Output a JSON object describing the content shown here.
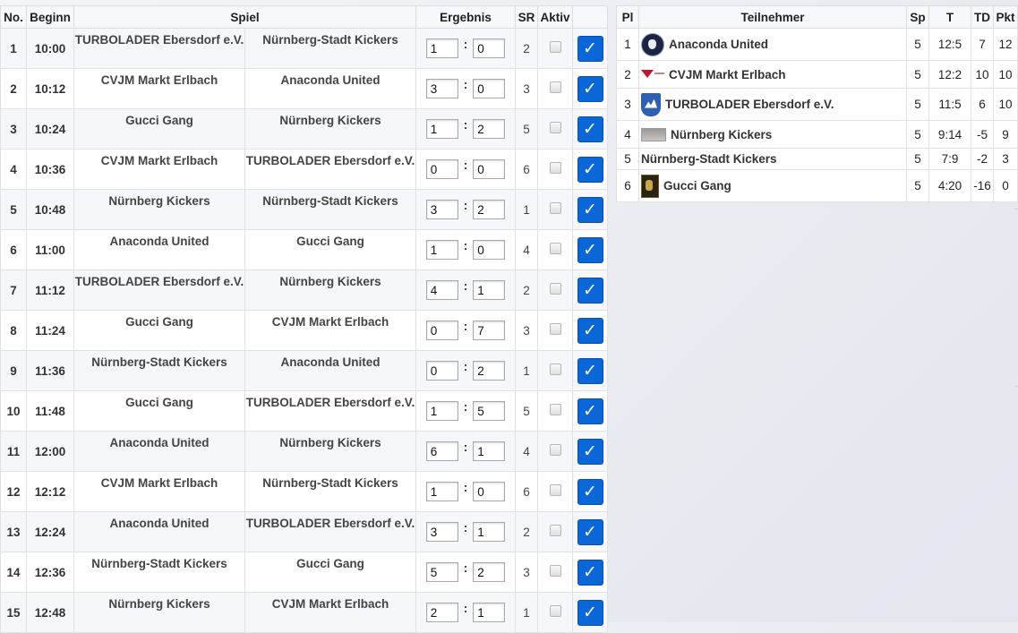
{
  "games": {
    "headers": {
      "no": "No.",
      "start": "Beginn",
      "game": "Spiel",
      "result": "Ergebnis",
      "sr": "SR",
      "active": "Aktiv"
    },
    "rows": [
      {
        "no": "1",
        "time": "10:00",
        "home": "TURBOLADER Ebersdorf e.V.",
        "away": "Nürnberg-Stadt Kickers",
        "score_home": "1",
        "score_away": "0",
        "sr": "2"
      },
      {
        "no": "2",
        "time": "10:12",
        "home": "CVJM Markt Erlbach",
        "away": "Anaconda United",
        "score_home": "3",
        "score_away": "0",
        "sr": "3"
      },
      {
        "no": "3",
        "time": "10:24",
        "home": "Gucci Gang",
        "away": "Nürnberg Kickers",
        "score_home": "1",
        "score_away": "2",
        "sr": "5"
      },
      {
        "no": "4",
        "time": "10:36",
        "home": "CVJM Markt Erlbach",
        "away": "TURBOLADER Ebersdorf e.V.",
        "score_home": "0",
        "score_away": "0",
        "sr": "6"
      },
      {
        "no": "5",
        "time": "10:48",
        "home": "Nürnberg Kickers",
        "away": "Nürnberg-Stadt Kickers",
        "score_home": "3",
        "score_away": "2",
        "sr": "1"
      },
      {
        "no": "6",
        "time": "11:00",
        "home": "Anaconda United",
        "away": "Gucci Gang",
        "score_home": "1",
        "score_away": "0",
        "sr": "4"
      },
      {
        "no": "7",
        "time": "11:12",
        "home": "TURBOLADER Ebersdorf e.V.",
        "away": "Nürnberg Kickers",
        "score_home": "4",
        "score_away": "1",
        "sr": "2"
      },
      {
        "no": "8",
        "time": "11:24",
        "home": "Gucci Gang",
        "away": "CVJM Markt Erlbach",
        "score_home": "0",
        "score_away": "7",
        "sr": "3"
      },
      {
        "no": "9",
        "time": "11:36",
        "home": "Nürnberg-Stadt Kickers",
        "away": "Anaconda United",
        "score_home": "0",
        "score_away": "2",
        "sr": "1"
      },
      {
        "no": "10",
        "time": "11:48",
        "home": "Gucci Gang",
        "away": "TURBOLADER Ebersdorf e.V.",
        "score_home": "1",
        "score_away": "5",
        "sr": "5"
      },
      {
        "no": "11",
        "time": "12:00",
        "home": "Anaconda United",
        "away": "Nürnberg Kickers",
        "score_home": "6",
        "score_away": "1",
        "sr": "4"
      },
      {
        "no": "12",
        "time": "12:12",
        "home": "CVJM Markt Erlbach",
        "away": "Nürnberg-Stadt Kickers",
        "score_home": "1",
        "score_away": "0",
        "sr": "6"
      },
      {
        "no": "13",
        "time": "12:24",
        "home": "Anaconda United",
        "away": "TURBOLADER Ebersdorf e.V.",
        "score_home": "3",
        "score_away": "1",
        "sr": "2"
      },
      {
        "no": "14",
        "time": "12:36",
        "home": "Nürnberg-Stadt Kickers",
        "away": "Gucci Gang",
        "score_home": "5",
        "score_away": "2",
        "sr": "3"
      },
      {
        "no": "15",
        "time": "12:48",
        "home": "Nürnberg Kickers",
        "away": "CVJM Markt Erlbach",
        "score_home": "2",
        "score_away": "1",
        "sr": "1"
      }
    ],
    "colon": ":",
    "confirm_icon": "checkmark-icon",
    "confirm_glyph": "✓",
    "confirm_color": "#0b67d8"
  },
  "standings": {
    "headers": {
      "pl": "Pl",
      "participant": "Teilnehmer",
      "sp": "Sp",
      "t": "T",
      "td": "TD",
      "pkt": "Pkt"
    },
    "rows": [
      {
        "pl": "1",
        "team": "Anaconda United",
        "logo": "anaconda-logo-icon",
        "sp": "5",
        "t": "12:5",
        "td": "7",
        "pkt": "12"
      },
      {
        "pl": "2",
        "team": "CVJM Markt Erlbach",
        "logo": "cvjm-logo-icon",
        "sp": "5",
        "t": "12:2",
        "td": "10",
        "pkt": "10"
      },
      {
        "pl": "3",
        "team": "TURBOLADER Ebersdorf e.V.",
        "logo": "turbolader-logo-icon",
        "sp": "5",
        "t": "11:5",
        "td": "6",
        "pkt": "10"
      },
      {
        "pl": "4",
        "team": "Nürnberg Kickers",
        "logo": "kickers-logo-icon",
        "sp": "5",
        "t": "9:14",
        "td": "-5",
        "pkt": "9"
      },
      {
        "pl": "5",
        "team": "Nürnberg-Stadt Kickers",
        "logo": "",
        "sp": "5",
        "t": "7:9",
        "td": "-2",
        "pkt": "3"
      },
      {
        "pl": "6",
        "team": "Gucci Gang",
        "logo": "gucci-logo-icon",
        "sp": "5",
        "t": "4:20",
        "td": "-16",
        "pkt": "0"
      }
    ]
  }
}
